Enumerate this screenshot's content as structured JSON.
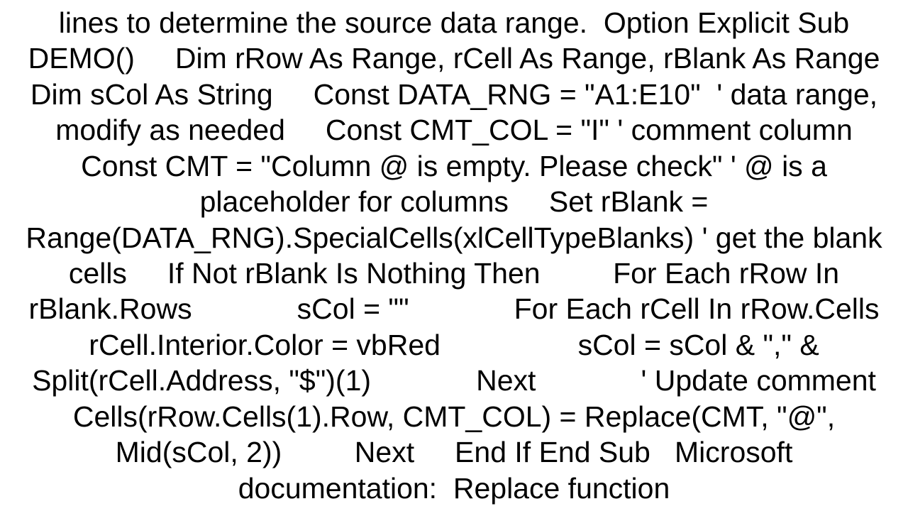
{
  "document": {
    "body_text": "lines to determine the source data range.  Option Explicit Sub DEMO()     Dim rRow As Range, rCell As Range, rBlank As Range     Dim sCol As String     Const DATA_RNG = \"A1:E10\"  ' data range, modify as needed     Const CMT_COL = \"I\" ' comment column     Const CMT = \"Column @ is empty. Please check\" ' @ is a placeholder for columns     Set rBlank = Range(DATA_RNG).SpecialCells(xlCellTypeBlanks) ' get the blank cells     If Not rBlank Is Nothing Then         For Each rRow In rBlank.Rows             sCol = \"\"             For Each rCell In rRow.Cells                 rCell.Interior.Color = vbRed                 sCol = sCol & \",\" & Split(rCell.Address, \"$\")(1)             Next             ' Update comment             Cells(rRow.Cells(1).Row, CMT_COL) = Replace(CMT, \"@\", Mid(sCol, 2))         Next     End If End Sub   Microsoft documentation:  Replace function"
  }
}
